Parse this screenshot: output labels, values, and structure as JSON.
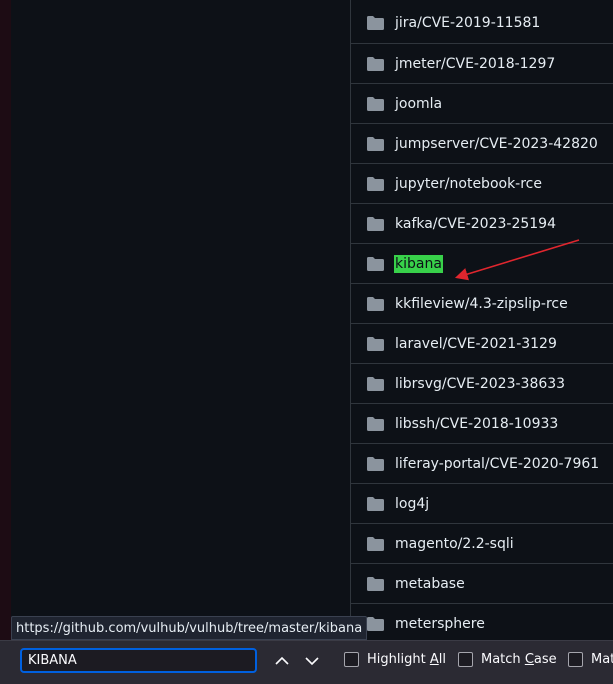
{
  "folders": [
    "jira/CVE-2019-11581",
    "jmeter/CVE-2018-1297",
    "joomla",
    "jumpserver/CVE-2023-42820",
    "jupyter/notebook-rce",
    "kafka/CVE-2023-25194",
    "kibana",
    "kkfileview/4.3-zipslip-rce",
    "laravel/CVE-2021-3129",
    "librsvg/CVE-2023-38633",
    "libssh/CVE-2018-10933",
    "liferay-portal/CVE-2020-7961",
    "log4j",
    "magento/2.2-sqli",
    "metabase",
    "metersphere"
  ],
  "highlighted_index": 6,
  "status_url": "https://github.com/vulhub/vulhub/tree/master/kibana",
  "findbar": {
    "query": "KIBANA",
    "prev_icon": "chevron-up-icon",
    "next_icon": "chevron-down-icon",
    "highlight_all_pre": "Highlight ",
    "highlight_all_key": "A",
    "highlight_all_post": "ll",
    "match_case_pre": "Match ",
    "match_case_key": "C",
    "match_case_post": "ase",
    "match_diacritics_text": "Mat"
  },
  "colors": {
    "highlight": "#38d14a",
    "annotation_arrow": "#e0262e",
    "focus_ring": "#0060df"
  }
}
